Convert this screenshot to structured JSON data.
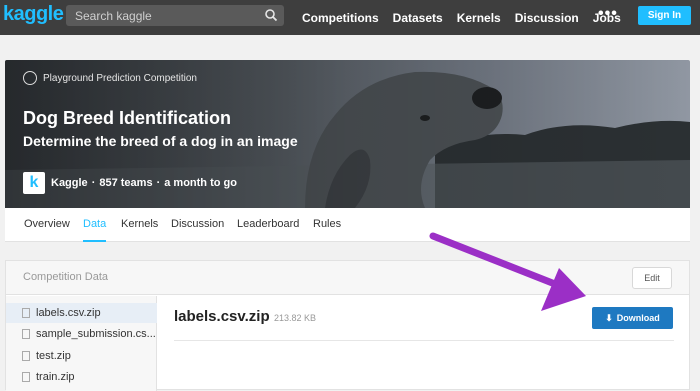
{
  "topnav": {
    "logo": "kaggle",
    "search_placeholder": "Search kaggle",
    "links": [
      "Competitions",
      "Datasets",
      "Kernels",
      "Discussion",
      "Jobs"
    ],
    "more": "•••",
    "signin_label": "Sign In"
  },
  "hero": {
    "tag": "Playground Prediction Competition",
    "title": "Dog Breed Identification",
    "subtitle": "Determine the breed of a dog in an image",
    "host_logo_letter": "k",
    "host": "Kaggle",
    "separator": "·",
    "teams": "857 teams",
    "time_left": "a month to go"
  },
  "tabs": [
    "Overview",
    "Data",
    "Kernels",
    "Discussion",
    "Leaderboard",
    "Rules"
  ],
  "active_tab": "Data",
  "competition_data": {
    "title": "Competition Data",
    "edit_label": "Edit",
    "files": [
      "labels.csv.zip",
      "sample_submission.cs...",
      "test.zip",
      "train.zip"
    ],
    "selected_file": "labels.csv.zip",
    "selected_size": "213.82 KB",
    "download_label": "Download"
  },
  "colors": {
    "accent": "#20beff",
    "download": "#1e79c1",
    "arrow": "#9b2fc6",
    "nav_bg": "#3e3e3e"
  }
}
